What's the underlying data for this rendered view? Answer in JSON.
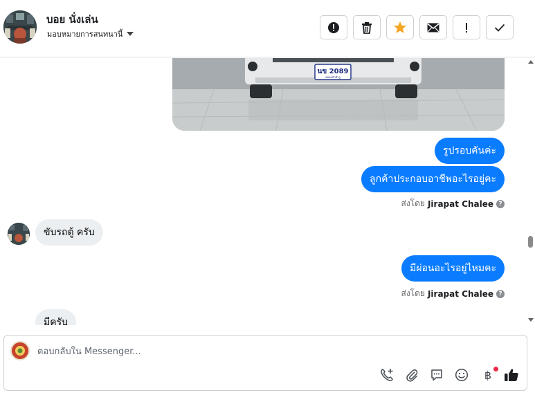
{
  "header": {
    "contact_name": "บอย นั่งเล่น",
    "assign_label": "มอบหมายการสนทนานี้",
    "tools": [
      {
        "name": "alert-icon"
      },
      {
        "name": "trash-icon"
      },
      {
        "name": "star-icon",
        "color": "#f5a623"
      },
      {
        "name": "envelope-icon"
      },
      {
        "name": "exclamation-icon"
      },
      {
        "name": "check-icon"
      }
    ]
  },
  "photo": {
    "plate_text": "นข 2089",
    "plate_province": "หนองบัวลำภู"
  },
  "messages": [
    {
      "dir": "out",
      "text": "รูปรอบคันค่ะ"
    },
    {
      "dir": "out",
      "text": "ลูกค้าประกอบอาชีพอะไรอยู่คะ"
    },
    {
      "dir": "meta",
      "prefix": "ส่งโดย",
      "agent": "Jirapat Chalee"
    },
    {
      "dir": "in",
      "text": "ขับรถตู้ ครับ"
    },
    {
      "dir": "out",
      "text": "มีผ่อนอะไรอยู่ไหมคะ"
    },
    {
      "dir": "meta",
      "prefix": "ส่งโดย",
      "agent": "Jirapat Chalee"
    },
    {
      "dir": "in",
      "text": "มีครับ"
    }
  ],
  "composer": {
    "placeholder": "ตอบกลับใน Messenger...",
    "currency_symbol": "฿",
    "tools": [
      "phone-add-icon",
      "paperclip-icon",
      "saved-reply-icon",
      "emoji-icon",
      "baht-payment-icon",
      "thumbs-up-icon"
    ]
  },
  "colors": {
    "outgoing_bubble": "#0a7cff",
    "incoming_bubble": "#eceff1",
    "accent_star": "#f5a623"
  }
}
